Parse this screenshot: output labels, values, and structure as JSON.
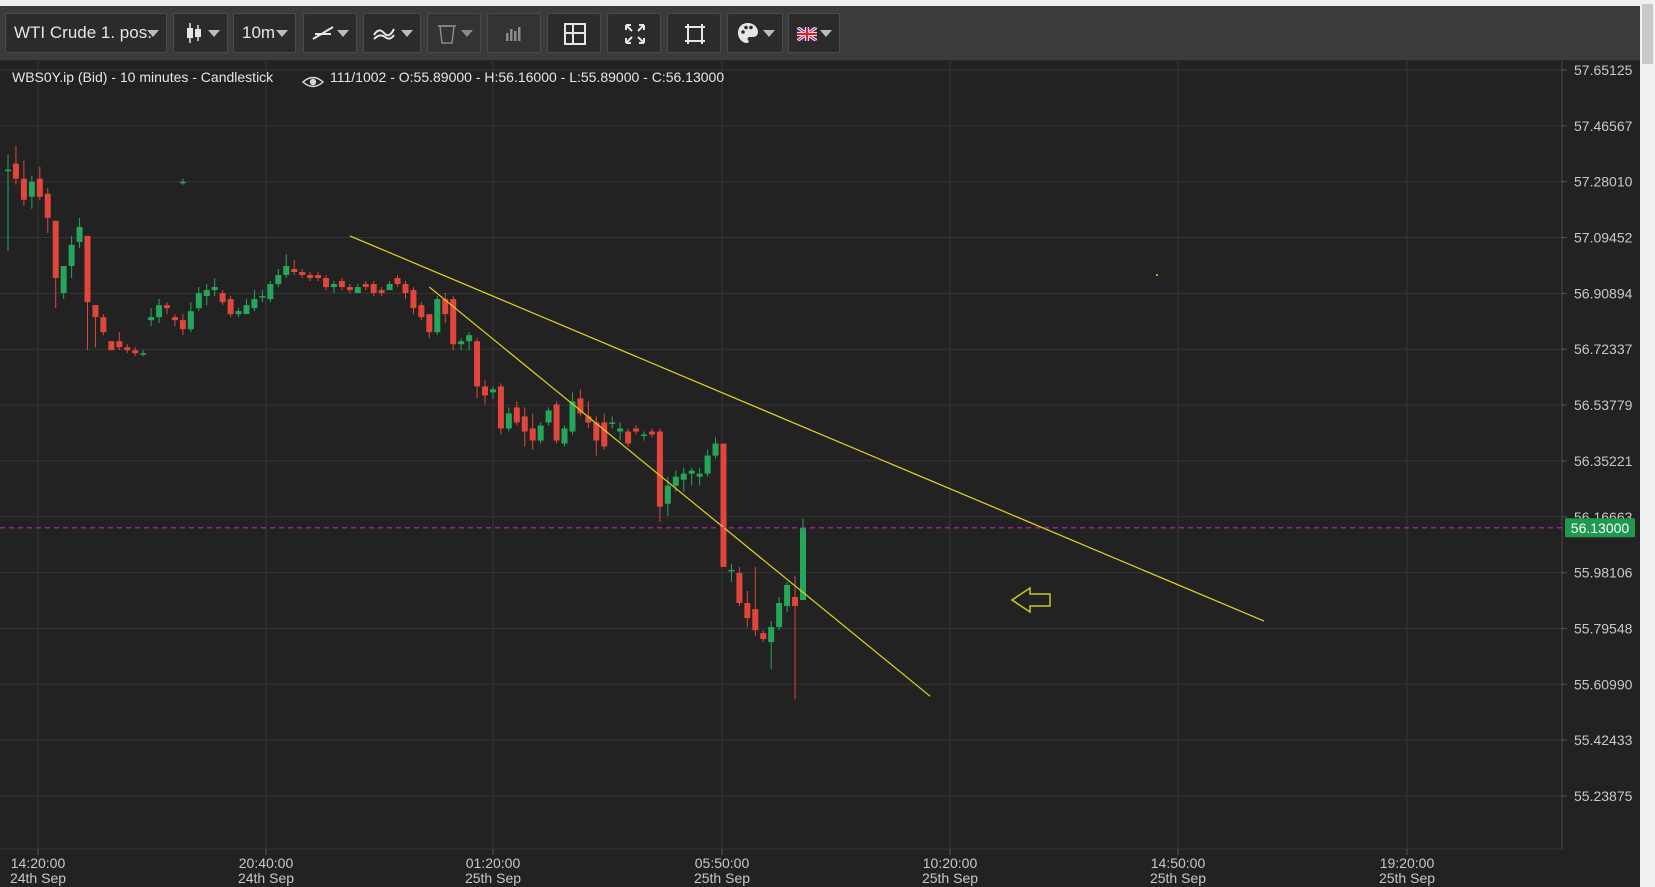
{
  "toolbar": {
    "instrument": "WTI Crude 1. pos.",
    "interval": "10m",
    "icons": [
      "candlestick-icon",
      "trendline-icon",
      "indicator-icon",
      "trash-icon",
      "volume-icon",
      "crosshair-icon",
      "fit-icon",
      "fullscreen-icon",
      "palette-icon",
      "uk-flag-icon"
    ],
    "colors": {
      "background": "#3b3b3b",
      "button": "#2b2b2b",
      "text": "#e6e6e6"
    }
  },
  "chart_info": {
    "symbol_line": "WBS0Y.ip (Bid) - 10 minutes - Candlestick",
    "ohlc_line": "111/1002 - O:55.89000 - H:56.16000 - L:55.89000 - C:56.13000"
  },
  "chart_data": {
    "type": "candlestick",
    "price_axis": [
      "57.65125",
      "57.46567",
      "57.28010",
      "57.09452",
      "56.90894",
      "56.72337",
      "56.53779",
      "56.35221",
      "56.16663",
      "55.98106",
      "55.79548",
      "55.60990",
      "55.42433",
      "55.23875"
    ],
    "ylim": [
      55.23875,
      57.65125
    ],
    "current_price": "56.13000",
    "current_price_value": 56.13,
    "time_axis": [
      {
        "time": "14:20:00",
        "date": "24th Sep"
      },
      {
        "time": "20:40:00",
        "date": "24th Sep"
      },
      {
        "time": "01:20:00",
        "date": "25th Sep"
      },
      {
        "time": "05:50:00",
        "date": "25th Sep"
      },
      {
        "time": "10:20:00",
        "date": "25th Sep"
      },
      {
        "time": "14:50:00",
        "date": "25th Sep"
      },
      {
        "time": "19:20:00",
        "date": "25th Sep"
      }
    ],
    "candles": [
      {
        "o": 57.32,
        "h": 57.37,
        "l": 57.05,
        "c": 57.32
      },
      {
        "o": 57.34,
        "h": 57.4,
        "l": 57.27,
        "c": 57.29
      },
      {
        "o": 57.29,
        "h": 57.35,
        "l": 57.2,
        "c": 57.22
      },
      {
        "o": 57.23,
        "h": 57.3,
        "l": 57.19,
        "c": 57.28
      },
      {
        "o": 57.29,
        "h": 57.33,
        "l": 57.22,
        "c": 57.23
      },
      {
        "o": 57.24,
        "h": 57.26,
        "l": 57.11,
        "c": 57.16
      },
      {
        "o": 57.15,
        "h": 57.15,
        "l": 56.86,
        "c": 56.96
      },
      {
        "o": 56.91,
        "h": 56.97,
        "l": 56.89,
        "c": 57.0
      },
      {
        "o": 57.0,
        "h": 57.1,
        "l": 56.96,
        "c": 57.07
      },
      {
        "o": 57.08,
        "h": 57.16,
        "l": 57.06,
        "c": 57.13
      },
      {
        "o": 57.1,
        "h": 57.1,
        "l": 56.72,
        "c": 56.88
      },
      {
        "o": 56.87,
        "h": 56.87,
        "l": 56.73,
        "c": 56.83
      },
      {
        "o": 56.83,
        "h": 56.84,
        "l": 56.77,
        "c": 56.78
      },
      {
        "o": 56.75,
        "h": 56.75,
        "l": 56.72,
        "c": 56.72
      },
      {
        "o": 56.75,
        "h": 56.78,
        "l": 56.72,
        "c": 56.73
      },
      {
        "o": 56.73,
        "h": 56.74,
        "l": 56.71,
        "c": 56.72
      },
      {
        "o": 56.72,
        "h": 56.73,
        "l": 56.7,
        "c": 56.71
      },
      {
        "o": 56.71,
        "h": 56.72,
        "l": 56.7,
        "c": 56.71
      },
      {
        "o": 56.82,
        "h": 56.86,
        "l": 56.8,
        "c": 56.83
      },
      {
        "o": 56.83,
        "h": 56.89,
        "l": 56.81,
        "c": 56.87
      },
      {
        "o": 56.87,
        "h": 56.88,
        "l": 56.84,
        "c": 56.86
      },
      {
        "o": 56.83,
        "h": 56.84,
        "l": 56.8,
        "c": 56.82
      },
      {
        "o": 56.82,
        "h": 56.84,
        "l": 56.77,
        "c": 56.79
      },
      {
        "o": 56.79,
        "h": 56.88,
        "l": 56.78,
        "c": 56.85
      },
      {
        "o": 56.86,
        "h": 56.93,
        "l": 56.85,
        "c": 56.91
      },
      {
        "o": 56.9,
        "h": 56.94,
        "l": 56.87,
        "c": 56.92
      },
      {
        "o": 56.92,
        "h": 56.96,
        "l": 56.9,
        "c": 56.93
      },
      {
        "o": 56.91,
        "h": 56.92,
        "l": 56.87,
        "c": 56.88
      },
      {
        "o": 56.89,
        "h": 56.9,
        "l": 56.83,
        "c": 56.84
      },
      {
        "o": 56.84,
        "h": 56.86,
        "l": 56.83,
        "c": 56.85
      },
      {
        "o": 56.84,
        "h": 56.89,
        "l": 56.84,
        "c": 56.87
      },
      {
        "o": 56.86,
        "h": 56.92,
        "l": 56.85,
        "c": 56.89
      },
      {
        "o": 56.9,
        "h": 56.92,
        "l": 56.88,
        "c": 56.9
      },
      {
        "o": 56.89,
        "h": 56.95,
        "l": 56.88,
        "c": 56.94
      },
      {
        "o": 56.94,
        "h": 56.99,
        "l": 56.93,
        "c": 56.97
      },
      {
        "o": 56.97,
        "h": 57.04,
        "l": 56.96,
        "c": 57.0
      },
      {
        "o": 56.99,
        "h": 57.02,
        "l": 56.97,
        "c": 56.98
      },
      {
        "o": 56.98,
        "h": 56.99,
        "l": 56.96,
        "c": 56.97
      },
      {
        "o": 56.97,
        "h": 56.98,
        "l": 56.95,
        "c": 56.96
      },
      {
        "o": 56.97,
        "h": 56.98,
        "l": 56.95,
        "c": 56.96
      },
      {
        "o": 56.96,
        "h": 56.97,
        "l": 56.92,
        "c": 56.93
      },
      {
        "o": 56.93,
        "h": 56.95,
        "l": 56.91,
        "c": 56.94
      },
      {
        "o": 56.95,
        "h": 56.96,
        "l": 56.92,
        "c": 56.93
      },
      {
        "o": 56.93,
        "h": 56.94,
        "l": 56.91,
        "c": 56.92
      },
      {
        "o": 56.91,
        "h": 56.94,
        "l": 56.91,
        "c": 56.93
      },
      {
        "o": 56.94,
        "h": 56.95,
        "l": 56.92,
        "c": 56.93
      },
      {
        "o": 56.94,
        "h": 56.95,
        "l": 56.9,
        "c": 56.91
      },
      {
        "o": 56.92,
        "h": 56.93,
        "l": 56.9,
        "c": 56.91
      },
      {
        "o": 56.92,
        "h": 56.95,
        "l": 56.92,
        "c": 56.94
      },
      {
        "o": 56.96,
        "h": 56.97,
        "l": 56.93,
        "c": 56.94
      },
      {
        "o": 56.94,
        "h": 56.95,
        "l": 56.89,
        "c": 56.91
      },
      {
        "o": 56.92,
        "h": 56.93,
        "l": 56.84,
        "c": 56.86
      },
      {
        "o": 56.87,
        "h": 56.88,
        "l": 56.82,
        "c": 56.83
      },
      {
        "o": 56.84,
        "h": 56.84,
        "l": 56.76,
        "c": 56.78
      },
      {
        "o": 56.78,
        "h": 56.9,
        "l": 56.77,
        "c": 56.89
      },
      {
        "o": 56.89,
        "h": 56.91,
        "l": 56.81,
        "c": 56.84
      },
      {
        "o": 56.89,
        "h": 56.9,
        "l": 56.72,
        "c": 56.74
      },
      {
        "o": 56.74,
        "h": 56.76,
        "l": 56.72,
        "c": 56.75
      },
      {
        "o": 56.75,
        "h": 56.78,
        "l": 56.72,
        "c": 56.77
      },
      {
        "o": 56.75,
        "h": 56.76,
        "l": 56.56,
        "c": 56.6
      },
      {
        "o": 56.6,
        "h": 56.62,
        "l": 56.54,
        "c": 56.57
      },
      {
        "o": 56.58,
        "h": 56.6,
        "l": 56.56,
        "c": 56.59
      },
      {
        "o": 56.6,
        "h": 56.61,
        "l": 56.44,
        "c": 56.46
      },
      {
        "o": 56.46,
        "h": 56.53,
        "l": 56.45,
        "c": 56.51
      },
      {
        "o": 56.53,
        "h": 56.55,
        "l": 56.47,
        "c": 56.48
      },
      {
        "o": 56.5,
        "h": 56.53,
        "l": 56.4,
        "c": 56.45
      },
      {
        "o": 56.46,
        "h": 56.51,
        "l": 56.39,
        "c": 56.42
      },
      {
        "o": 56.42,
        "h": 56.48,
        "l": 56.41,
        "c": 56.47
      },
      {
        "o": 56.48,
        "h": 56.53,
        "l": 56.47,
        "c": 56.52
      },
      {
        "o": 56.54,
        "h": 56.55,
        "l": 56.41,
        "c": 56.42
      },
      {
        "o": 56.41,
        "h": 56.47,
        "l": 56.4,
        "c": 56.46
      },
      {
        "o": 56.45,
        "h": 56.58,
        "l": 56.44,
        "c": 56.55
      },
      {
        "o": 56.56,
        "h": 56.59,
        "l": 56.5,
        "c": 56.51
      },
      {
        "o": 56.5,
        "h": 56.55,
        "l": 56.46,
        "c": 56.48
      },
      {
        "o": 56.48,
        "h": 56.5,
        "l": 56.37,
        "c": 56.42
      },
      {
        "o": 56.48,
        "h": 56.51,
        "l": 56.39,
        "c": 56.4
      },
      {
        "o": 56.48,
        "h": 56.5,
        "l": 56.46,
        "c": 56.48
      },
      {
        "o": 56.45,
        "h": 56.48,
        "l": 56.42,
        "c": 56.46
      },
      {
        "o": 56.45,
        "h": 56.46,
        "l": 56.4,
        "c": 56.41
      },
      {
        "o": 56.46,
        "h": 56.47,
        "l": 56.44,
        "c": 56.45
      },
      {
        "o": 56.44,
        "h": 56.45,
        "l": 56.42,
        "c": 56.44
      },
      {
        "o": 56.45,
        "h": 56.46,
        "l": 56.43,
        "c": 56.44
      },
      {
        "o": 56.45,
        "h": 56.46,
        "l": 56.15,
        "c": 56.2
      },
      {
        "o": 56.21,
        "h": 56.3,
        "l": 56.17,
        "c": 56.27
      },
      {
        "o": 56.27,
        "h": 56.32,
        "l": 56.25,
        "c": 56.3
      },
      {
        "o": 56.29,
        "h": 56.33,
        "l": 56.25,
        "c": 56.31
      },
      {
        "o": 56.31,
        "h": 56.33,
        "l": 56.27,
        "c": 56.32
      },
      {
        "o": 56.3,
        "h": 56.33,
        "l": 56.27,
        "c": 56.31
      },
      {
        "o": 56.31,
        "h": 56.39,
        "l": 56.3,
        "c": 56.37
      },
      {
        "o": 56.37,
        "h": 56.43,
        "l": 56.36,
        "c": 56.41
      },
      {
        "o": 56.41,
        "h": 56.41,
        "l": 56.0,
        "c": 56.0
      },
      {
        "o": 55.99,
        "h": 56.01,
        "l": 55.95,
        "c": 55.99
      },
      {
        "o": 55.98,
        "h": 56.0,
        "l": 55.87,
        "c": 55.88
      },
      {
        "o": 55.88,
        "h": 55.92,
        "l": 55.8,
        "c": 55.83
      },
      {
        "o": 55.86,
        "h": 56.0,
        "l": 55.77,
        "c": 55.79
      },
      {
        "o": 55.78,
        "h": 55.79,
        "l": 55.75,
        "c": 55.76
      },
      {
        "o": 55.75,
        "h": 55.82,
        "l": 55.66,
        "c": 55.8
      },
      {
        "o": 55.8,
        "h": 55.9,
        "l": 55.79,
        "c": 55.88
      },
      {
        "o": 55.87,
        "h": 55.95,
        "l": 55.85,
        "c": 55.94
      },
      {
        "o": 55.9,
        "h": 55.97,
        "l": 55.56,
        "c": 55.87
      },
      {
        "o": 55.89,
        "h": 56.16,
        "l": 55.89,
        "c": 56.13
      }
    ],
    "stray_candles": [
      {
        "index": 22,
        "o": 57.28,
        "h": 57.29,
        "l": 57.27,
        "c": 57.28
      }
    ],
    "trendlines": [
      {
        "from": {
          "index": 43,
          "price": 57.1
        },
        "to": {
          "index": 158,
          "price": 55.82
        }
      },
      {
        "from": {
          "index": 53,
          "price": 56.93
        },
        "to": {
          "index": 116,
          "price": 55.57
        }
      }
    ],
    "colors": {
      "up": "#26a65b",
      "down": "#e0463c",
      "trendline": "#e3d41d",
      "price_line": "#c21dc2",
      "price_label": "#1f9950",
      "grid": "#353535",
      "axis_text": "#c8c8c8"
    }
  }
}
